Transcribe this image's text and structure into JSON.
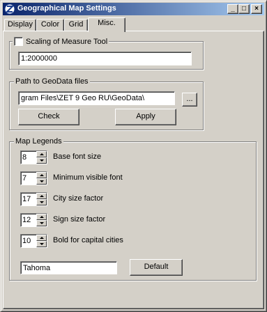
{
  "window": {
    "title": "Geographical Map Settings",
    "min_glyph": "_",
    "max_glyph": "□",
    "close_glyph": "×"
  },
  "tabs": [
    {
      "label": "Display",
      "active": false
    },
    {
      "label": "Color",
      "active": false
    },
    {
      "label": "Grid",
      "active": false
    },
    {
      "label": "Misc.",
      "active": true
    }
  ],
  "scaling": {
    "checkbox_label": "Scaling of Measure Tool",
    "checked": false,
    "value": "1:2000000"
  },
  "geodata": {
    "group_label": "Path to GeoData files",
    "path": "gram Files\\ZET 9 Geo RU\\GeoData\\",
    "browse_label": "...",
    "check_label": "Check",
    "apply_label": "Apply"
  },
  "legends": {
    "group_label": "Map Legends",
    "rows": [
      {
        "value": "8",
        "label": "Base font size"
      },
      {
        "value": "7",
        "label": "Minimum visible font"
      },
      {
        "value": "17",
        "label": "City size factor"
      },
      {
        "value": "12",
        "label": "Sign size factor"
      },
      {
        "value": "10",
        "label": "Bold for capital cities"
      }
    ],
    "font_value": "Tahoma",
    "default_label": "Default"
  },
  "colors": {
    "titlebar_start": "#0a246a",
    "titlebar_end": "#a6caf0",
    "face": "#d4d0c8"
  }
}
